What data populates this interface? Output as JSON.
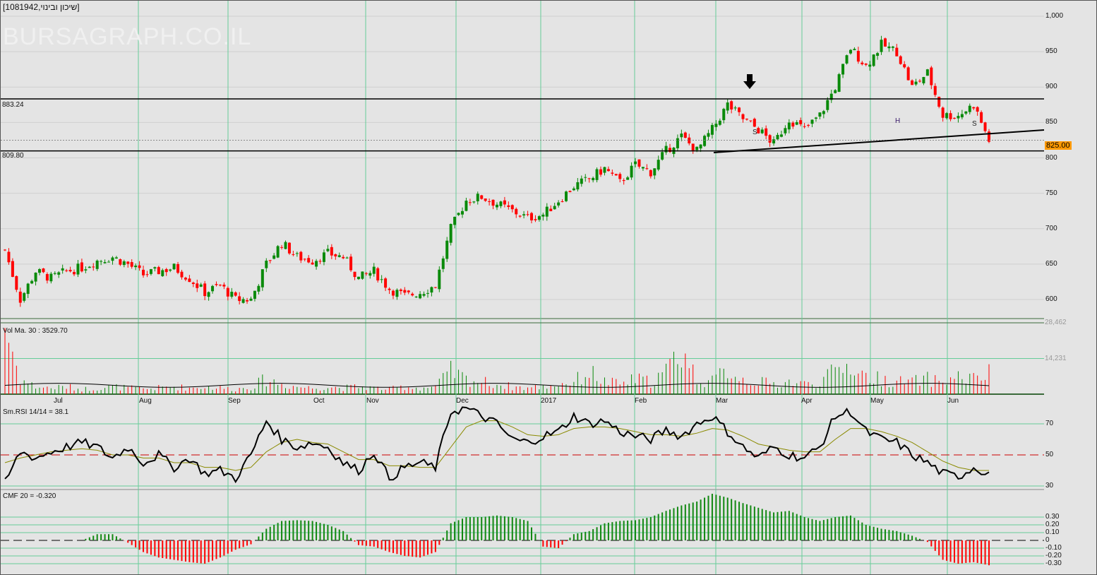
{
  "header": {
    "title": "[שיכון ובינוי,1081942]",
    "watermark": "BURSAGRAPH.CO.IL"
  },
  "colors": {
    "up": "#0a8a0a",
    "down": "#ff0000",
    "grid": "#66cc99",
    "bg": "#e4e4e4",
    "last_label": "#ff9900"
  },
  "chart_data": [
    {
      "type": "candlestick",
      "title": "Price",
      "ylim": [
        580,
        1010
      ],
      "yticks": [
        "1,000",
        "950",
        "900",
        "850",
        "800",
        "750",
        "700",
        "650",
        "600"
      ],
      "ytick_values": [
        1000,
        950,
        900,
        850,
        800,
        750,
        700,
        650,
        600
      ],
      "x_labels": [
        "Jul",
        "Aug",
        "Sep",
        "Oct",
        "Nov",
        "Dec",
        "2017",
        "Feb",
        "Mar",
        "Apr",
        "May",
        "Jun"
      ],
      "closes": [
        670,
        600,
        640,
        630,
        640,
        645,
        655,
        660,
        650,
        635,
        640,
        645,
        630,
        610,
        620,
        600,
        600,
        650,
        680,
        660,
        655,
        665,
        660,
        630,
        640,
        615,
        605,
        610,
        620,
        700,
        740,
        745,
        735,
        725,
        715,
        720,
        740,
        760,
        770,
        785,
        765,
        790,
        780,
        810,
        830,
        810,
        840,
        875,
        855,
        840,
        820,
        855,
        840,
        860,
        900,
        955,
        930,
        960,
        950,
        900,
        920,
        860,
        860,
        875,
        825
      ],
      "levels": [
        {
          "value": 883.24,
          "label": "883.24"
        },
        {
          "value": 809.8,
          "label": "809.80"
        }
      ],
      "last_price": {
        "value": 825.0,
        "label": "825.00"
      },
      "annotations": [
        "S",
        "H",
        "S"
      ]
    },
    {
      "type": "bar",
      "title": "Vol Ma. 30 : 3529.70",
      "yticks": [
        "28,462",
        "14,231"
      ],
      "ytick_values": [
        28462,
        14231
      ],
      "values": [
        28000,
        6000,
        3000,
        2500,
        3000,
        2000,
        2500,
        3000,
        2500,
        2000,
        2500,
        3000,
        2500,
        3000,
        2500,
        2000,
        3000,
        6000,
        4000,
        3000,
        2500,
        3000,
        2500,
        3000,
        2500,
        2000,
        3000,
        2500,
        3000,
        9000,
        6000,
        5000,
        4000,
        3000,
        2500,
        3000,
        4000,
        5000,
        9000,
        5000,
        4000,
        6000,
        5000,
        9000,
        18000,
        6000,
        5000,
        10000,
        6000,
        5000,
        4000,
        5000,
        4000,
        5000,
        9000,
        12000,
        7000,
        6000,
        5000,
        5000,
        6000,
        5000,
        7000,
        6000,
        8000
      ],
      "ma": 3529.7
    },
    {
      "type": "line",
      "title": "Sm.RSI 14/14 = 38.1",
      "yticks": [
        "70",
        "50",
        "30"
      ],
      "ytick_values": [
        70,
        50,
        30
      ],
      "values": [
        32,
        52,
        48,
        52,
        55,
        58,
        55,
        48,
        55,
        45,
        50,
        42,
        48,
        38,
        40,
        35,
        50,
        72,
        60,
        55,
        58,
        55,
        45,
        40,
        52,
        35,
        42,
        45,
        42,
        78,
        80,
        75,
        70,
        60,
        58,
        62,
        65,
        75,
        70,
        72,
        65,
        62,
        60,
        66,
        62,
        70,
        75,
        65,
        55,
        48,
        55,
        50,
        48,
        55,
        75,
        78,
        65,
        60,
        58,
        50,
        45,
        38,
        36,
        42,
        38
      ],
      "signal": [
        45,
        48,
        50,
        52,
        53,
        54,
        53,
        50,
        50,
        48,
        48,
        45,
        45,
        42,
        42,
        40,
        42,
        52,
        58,
        60,
        58,
        57,
        52,
        47,
        47,
        43,
        43,
        42,
        42,
        55,
        68,
        72,
        72,
        68,
        63,
        62,
        63,
        67,
        68,
        68,
        67,
        65,
        63,
        63,
        62,
        64,
        67,
        66,
        62,
        57,
        55,
        53,
        52,
        52,
        60,
        67,
        67,
        65,
        62,
        58,
        52,
        46,
        42,
        40,
        40
      ],
      "value": 38.1
    },
    {
      "type": "bar",
      "title": "CMF 20 = -0.320",
      "yticks": [
        "0.30",
        "0.20",
        "0.10",
        "0",
        "-0.10",
        "-0.20",
        "-0.30"
      ],
      "ytick_values": [
        0.3,
        0.2,
        0.1,
        0,
        -0.1,
        -0.2,
        -0.3
      ],
      "values": [
        0,
        0,
        0,
        0,
        0,
        0,
        0.08,
        0.08,
        -0.03,
        -0.15,
        -0.22,
        -0.25,
        -0.28,
        -0.3,
        -0.22,
        -0.12,
        -0.05,
        0.15,
        0.25,
        0.26,
        0.25,
        0.2,
        0.12,
        -0.06,
        -0.08,
        -0.15,
        -0.2,
        -0.22,
        -0.15,
        0.22,
        0.3,
        0.3,
        0.32,
        0.3,
        0.25,
        -0.08,
        -0.1,
        0.08,
        0.12,
        0.22,
        0.25,
        0.26,
        0.3,
        0.38,
        0.45,
        0.5,
        0.6,
        0.55,
        0.48,
        0.42,
        0.36,
        0.38,
        0.3,
        0.25,
        0.3,
        0.32,
        0.2,
        0.15,
        0.12,
        0.06,
        -0.02,
        -0.25,
        -0.3,
        -0.28,
        -0.32
      ]
    }
  ]
}
